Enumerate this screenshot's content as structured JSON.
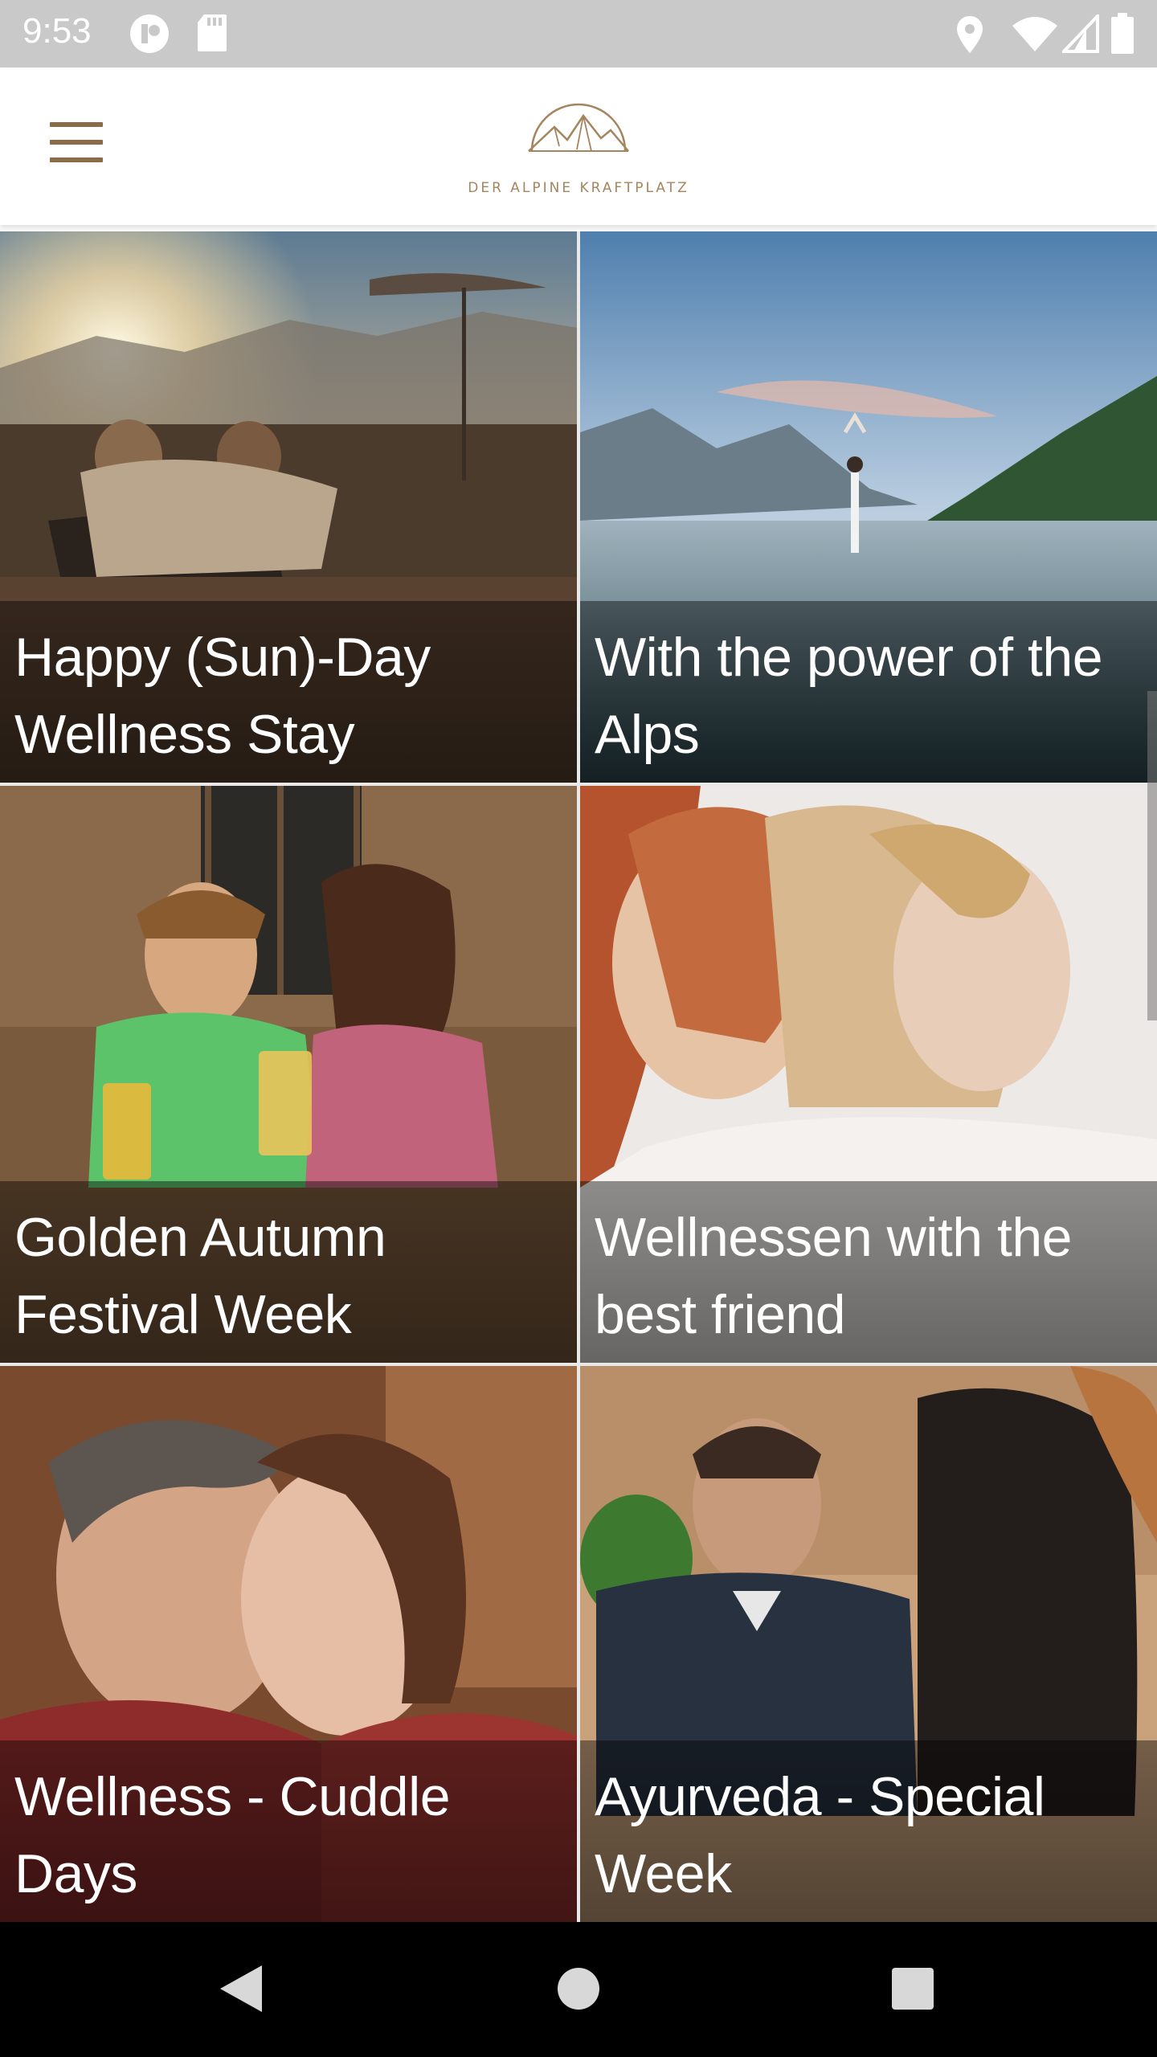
{
  "status_bar": {
    "time": "9:53",
    "icons": [
      "circle-app-icon",
      "sd-card-icon",
      "location-icon",
      "wifi-icon",
      "signal-icon",
      "battery-icon"
    ]
  },
  "app_bar": {
    "menu_icon": "hamburger-menu-icon",
    "logo_text": "DER ALPINE KRAFTPLATZ",
    "brand_color": "#a5855e"
  },
  "offers": [
    {
      "title_line1": "Happy (Sun)-Day",
      "title_line2": "Wellness Stay"
    },
    {
      "title_line1": "With the power of the",
      "title_line2": "Alps"
    },
    {
      "title_line1": "Golden Autumn",
      "title_line2": "Festival Week"
    },
    {
      "title_line1": "Wellnessen with the",
      "title_line2": "best friend"
    },
    {
      "title_line1": "Wellness - Cuddle",
      "title_line2": "Days"
    },
    {
      "title_line1": "Ayurveda - Special",
      "title_line2": "Week"
    }
  ],
  "nav_bar": {
    "icons": [
      "back-icon",
      "home-icon",
      "recents-icon"
    ]
  }
}
